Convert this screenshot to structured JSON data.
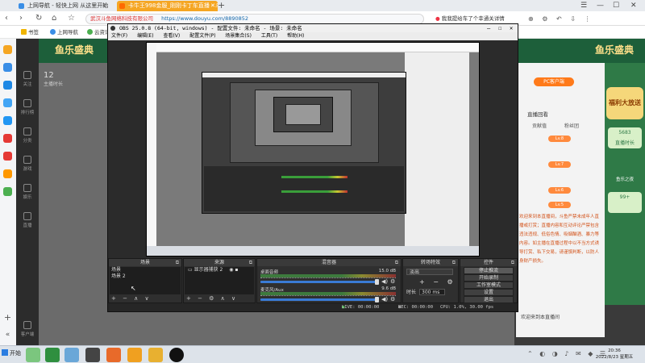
{
  "browser": {
    "tabs": [
      {
        "label": "上网导航 - 轻快上网 从这里开始"
      },
      {
        "label": "卡牛王998金服_刚刚卡丁车直播 - 斗..."
      }
    ],
    "url_site": "武汉斗鱼网络科技有限公司",
    "url": "https://www.douyu.com/8890852",
    "search_text": "我我提给车了个幸通关详情",
    "bookmarks": [
      "书签",
      "上网导航",
      "云资讯"
    ]
  },
  "douyu": {
    "logo_text": "鱼乐盛典",
    "sidebar": [
      "关注",
      "排行榜",
      "分类",
      "游戏",
      "娱乐",
      "直播",
      "客户端"
    ],
    "left_numbers": [
      "12",
      "主播时长"
    ],
    "right_panel": {
      "pc_client_button": "PC客户端",
      "title": "直播回看",
      "tabs": [
        "贡献值",
        "粉丝团"
      ],
      "badges": [
        "Lv.8",
        "Lv.7",
        "Lv.6",
        "Lv.5"
      ],
      "notice": "欢迎来到本直播间，斗鱼严禁未成年人直播或打赏；直播内容和互动评论严禁包含违法违规、低俗色情、吸烟酗酒、暴力等内容。如主播在直播过程中以不当方式诱导打赏、私下交易，请谨慎判断，以防人身财产损失。",
      "footer": "欢迎来到本直播间"
    },
    "ad": {
      "title": "鱼乐盛典",
      "lines": [
        "福利大放送",
        "5683",
        "直播时长",
        "鱼乐之夜",
        "99+"
      ]
    }
  },
  "obs": {
    "title": "OBS 25.0.8 (64-bit, windows) - 配置文件: 未命名 - 场景: 未命名",
    "menu": [
      "文件(F)",
      "编辑(E)",
      "查看(V)",
      "配置文件(P)",
      "场景集合(S)",
      "工具(T)",
      "帮助(H)"
    ],
    "docks": {
      "scenes": {
        "title": "场景",
        "items": [
          "场景",
          "场景 2"
        ]
      },
      "sources": {
        "title": "来源",
        "items": [
          "显示器捕获 2"
        ]
      },
      "mixer": {
        "title": "混音器",
        "channels": [
          {
            "name": "桌面音频",
            "db": "15.0 dB",
            "level": 0.86
          },
          {
            "name": "麦克风/Aux",
            "db": "9.6 dB",
            "level": 0.86
          }
        ]
      },
      "transitions": {
        "title": "转场特效",
        "selected": "淡出",
        "duration_label": "时长",
        "duration": "300 ms"
      },
      "controls": {
        "title": "控件",
        "buttons": [
          "停止推流",
          "开始录制",
          "工作室模式",
          "设置",
          "退出"
        ]
      }
    },
    "status": {
      "live": "LIVE: 00:00:00",
      "rec": "REC: 00:00:00",
      "cpu": "CPU: 1.0%, 30.00 fps"
    }
  },
  "taskbar": {
    "start": "开始",
    "time": "20:36",
    "date": "2022/8/23 星期五"
  },
  "colors": {
    "obs_bg": "#2b2b2b",
    "douyu_green": "#1d5f3a",
    "accent_orange": "#ff7a1a",
    "active_tab": "#f5a623"
  }
}
